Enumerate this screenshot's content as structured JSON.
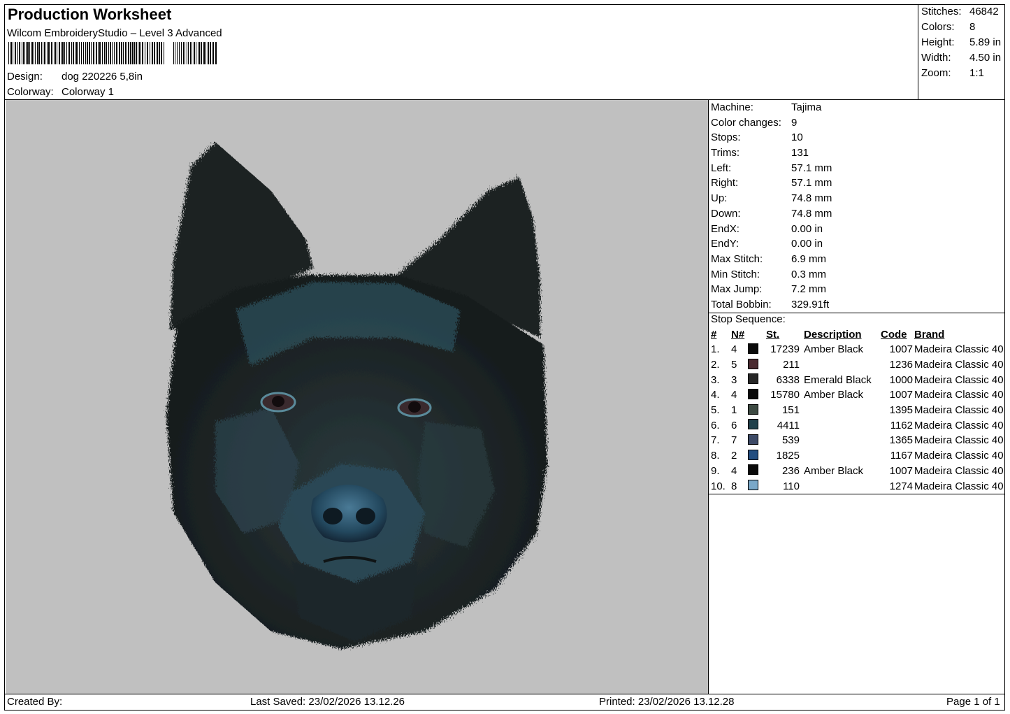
{
  "header": {
    "title": "Production Worksheet",
    "software": "Wilcom EmbroideryStudio – Level 3 Advanced",
    "design_label": "Design:",
    "design_value": "dog 220226 5,8in",
    "colorway_label": "Colorway:",
    "colorway_value": "Colorway 1"
  },
  "summary": [
    {
      "label": "Stitches:",
      "value": "46842"
    },
    {
      "label": "Colors:",
      "value": "8"
    },
    {
      "label": "Height:",
      "value": "5.89 in"
    },
    {
      "label": "Width:",
      "value": "4.50 in"
    },
    {
      "label": "Zoom:",
      "value": "1:1"
    }
  ],
  "info": [
    {
      "label": "Machine:",
      "value": "Tajima"
    },
    {
      "label": "Color changes:",
      "value": "9"
    },
    {
      "label": "Stops:",
      "value": "10"
    },
    {
      "label": "Trims:",
      "value": "131"
    },
    {
      "label": "Left:",
      "value": "57.1 mm"
    },
    {
      "label": "Right:",
      "value": "57.1 mm"
    },
    {
      "label": "Up:",
      "value": "74.8 mm"
    },
    {
      "label": "Down:",
      "value": "74.8 mm"
    },
    {
      "label": "EndX:",
      "value": "0.00 in"
    },
    {
      "label": "EndY:",
      "value": "0.00 in"
    },
    {
      "label": "Max Stitch:",
      "value": "6.9 mm"
    },
    {
      "label": "Min Stitch:",
      "value": "0.3 mm"
    },
    {
      "label": "Max Jump:",
      "value": "7.2 mm"
    },
    {
      "label": "Total Bobbin:",
      "value": "329.91ft"
    }
  ],
  "stop_sequence": {
    "title": "Stop Sequence:",
    "headers": {
      "idx": "#",
      "n": "N#",
      "st": "St.",
      "desc": "Description",
      "code": "Code",
      "brand": "Brand"
    },
    "rows": [
      {
        "idx": "1.",
        "n": "4",
        "color": "#0a0a0a",
        "st": "17239",
        "desc": "Amber Black",
        "code": "1007",
        "brand": "Madeira Classic 40"
      },
      {
        "idx": "2.",
        "n": "5",
        "color": "#4a2a30",
        "st": "211",
        "desc": "",
        "code": "1236",
        "brand": "Madeira Classic 40"
      },
      {
        "idx": "3.",
        "n": "3",
        "color": "#262626",
        "st": "6338",
        "desc": "Emerald Black",
        "code": "1000",
        "brand": "Madeira Classic 40"
      },
      {
        "idx": "4.",
        "n": "4",
        "color": "#0a0a0a",
        "st": "15780",
        "desc": "Amber Black",
        "code": "1007",
        "brand": "Madeira Classic 40"
      },
      {
        "idx": "5.",
        "n": "1",
        "color": "#3d4a42",
        "st": "151",
        "desc": "",
        "code": "1395",
        "brand": "Madeira Classic 40"
      },
      {
        "idx": "6.",
        "n": "6",
        "color": "#21404a",
        "st": "4411",
        "desc": "",
        "code": "1162",
        "brand": "Madeira Classic 40"
      },
      {
        "idx": "7.",
        "n": "7",
        "color": "#3d4a66",
        "st": "539",
        "desc": "",
        "code": "1365",
        "brand": "Madeira Classic 40"
      },
      {
        "idx": "8.",
        "n": "2",
        "color": "#234e80",
        "st": "1825",
        "desc": "",
        "code": "1167",
        "brand": "Madeira Classic 40"
      },
      {
        "idx": "9.",
        "n": "4",
        "color": "#0a0a0a",
        "st": "236",
        "desc": "Amber Black",
        "code": "1007",
        "brand": "Madeira Classic 40"
      },
      {
        "idx": "10.",
        "n": "8",
        "color": "#7aa8c8",
        "st": "110",
        "desc": "",
        "code": "1274",
        "brand": "Madeira Classic 40"
      }
    ]
  },
  "footer": {
    "created_by": "Created By:",
    "last_saved": "Last Saved: 23/02/2026 13.12.26",
    "printed": "Printed: 23/02/2026 13.12.28",
    "page": "Page 1 of 1"
  },
  "colors": {
    "preview_background": "#c0c0c0"
  }
}
